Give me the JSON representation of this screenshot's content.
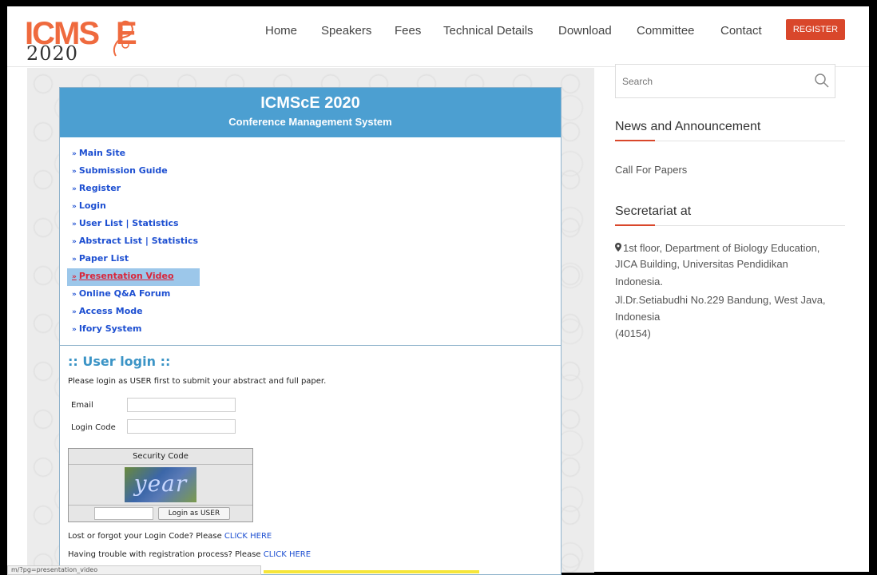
{
  "header": {
    "logo_main": "ICMS",
    "logo_e": "E",
    "logo_year": "2020",
    "nav": [
      "Home",
      "Speakers",
      "Fees",
      "Technical Details",
      "Download",
      "Committee",
      "Contact"
    ],
    "register_label": "REGISTER",
    "accent_color": "#d9472b"
  },
  "cms": {
    "title": "ICMScE 2020",
    "subtitle": "Conference Management System",
    "menu": [
      {
        "label": "Main Site",
        "active": false
      },
      {
        "label": "Submission Guide",
        "active": false
      },
      {
        "label": "Register",
        "active": false
      },
      {
        "label": "Login",
        "active": false
      },
      {
        "label": "User List | Statistics",
        "active": false
      },
      {
        "label": "Abstract List | Statistics",
        "active": false
      },
      {
        "label": "Paper List",
        "active": false
      },
      {
        "label": "Presentation Video",
        "active": true
      },
      {
        "label": "Online Q&A Forum",
        "active": false
      },
      {
        "label": "Access Mode",
        "active": false
      },
      {
        "label": "Ifory System",
        "active": false
      }
    ],
    "arrow": "»",
    "banner_color": "#4c9fd1"
  },
  "login": {
    "title": ":: User login ::",
    "note": "Please login as USER first to submit your abstract and full paper.",
    "email_label": "Email",
    "email_value": "",
    "code_label": "Login Code",
    "code_value": "",
    "security_label": "Security Code",
    "captcha_text": "year",
    "captcha_value": "",
    "button_label": "Login as USER",
    "lost_text": "Lost or forgot your Login Code? Please ",
    "lost_link": "CLICK HERE",
    "trouble_text": "Having trouble with registration process? Please ",
    "trouble_link": "CLICK HERE"
  },
  "status_bar": {
    "text": "m/?pg=presentation_video"
  },
  "sidebar": {
    "search_placeholder": "Search",
    "news_title": "News and Announcement",
    "news_items": [
      "Call For Papers"
    ],
    "secretariat_title": "Secretariat at",
    "address_lines": [
      "1st floor, Department of Biology Education,",
      "JICA Building, Universitas Pendidikan",
      "Indonesia.",
      "Jl.Dr.Setiabudhi No.229 Bandung, West Java,",
      "Indonesia",
      "(40154)"
    ],
    "icons": {
      "search": "search-icon",
      "location": "map-pin-icon"
    }
  }
}
